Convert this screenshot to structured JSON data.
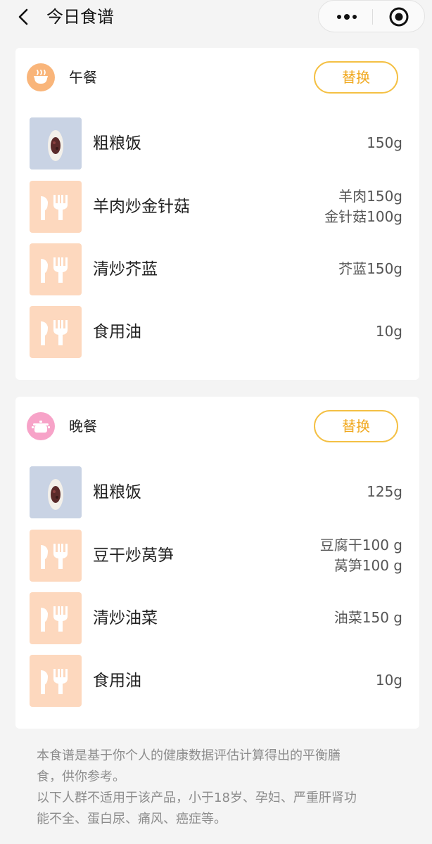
{
  "header": {
    "title": "今日食谱",
    "back_icon": "back-arrow-icon",
    "more_icon": "more-dots-icon",
    "close_icon": "target-circle-icon"
  },
  "meals": [
    {
      "name": "午餐",
      "icon": "rice-bowl-icon",
      "icon_color": "#f9b57a",
      "swap_label": "替换",
      "items": [
        {
          "name": "粗粮饭",
          "thumb": "food-photo",
          "amounts": [
            "150g"
          ]
        },
        {
          "name": "羊肉炒金针菇",
          "thumb": "cutlery-icon",
          "amounts": [
            "羊肉150g",
            "金针菇100g"
          ]
        },
        {
          "name": "清炒芥蓝",
          "thumb": "cutlery-icon",
          "amounts": [
            "芥蓝150g"
          ]
        },
        {
          "name": "食用油",
          "thumb": "cutlery-icon",
          "amounts": [
            "10g"
          ]
        }
      ]
    },
    {
      "name": "晚餐",
      "icon": "cooking-pot-icon",
      "icon_color": "#f7a3c8",
      "swap_label": "替换",
      "items": [
        {
          "name": "粗粮饭",
          "thumb": "food-photo",
          "amounts": [
            "125g"
          ]
        },
        {
          "name": "豆干炒莴笋",
          "thumb": "cutlery-icon",
          "amounts": [
            "豆腐干100 g",
            "莴笋100 g"
          ]
        },
        {
          "name": "清炒油菜",
          "thumb": "cutlery-icon",
          "amounts": [
            "油菜150 g"
          ]
        },
        {
          "name": "食用油",
          "thumb": "cutlery-icon",
          "amounts": [
            "10g"
          ]
        }
      ]
    }
  ],
  "footer": {
    "lines": [
      "本食谱是基于你个人的健康数据评估计算得出的平衡膳",
      "食，供你参考。",
      "以下人群不适用于该产品，小于18岁、孕妇、严重肝肾功",
      "能不全、蛋白尿、痛风、癌症等。"
    ]
  },
  "colors": {
    "accent": "#f0a81e",
    "button_border": "#f4c044",
    "thumb_bg": "#fdd8be",
    "page_bg": "#f4f4f4"
  }
}
